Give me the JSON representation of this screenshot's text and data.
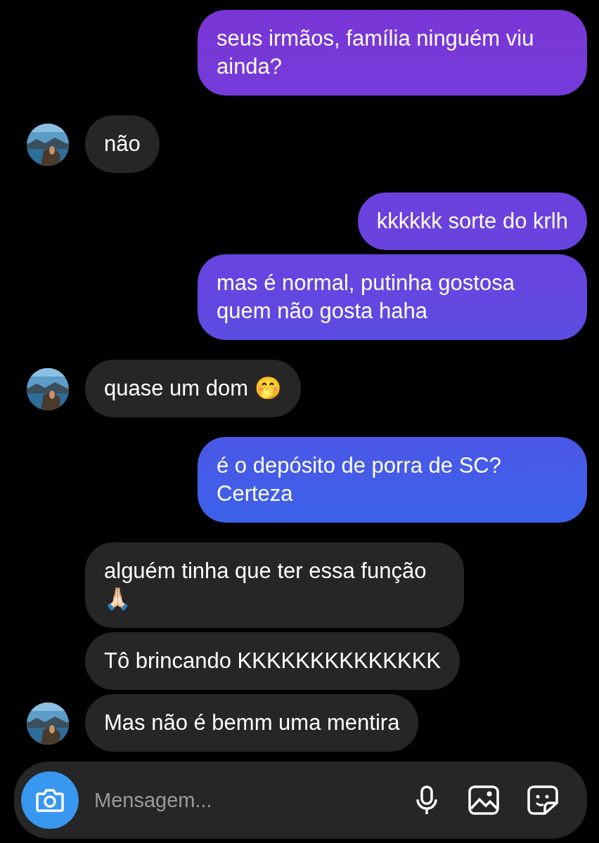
{
  "messages": [
    {
      "kind": "sent",
      "text": "seus irmãos, família ninguém viu ainda?"
    },
    {
      "kind": "received",
      "text": "não",
      "show_avatar": true
    },
    {
      "kind": "sent",
      "text": "kkkkkk sorte do krlh"
    },
    {
      "kind": "sent",
      "text": "mas é normal, putinha gostosa quem não gosta haha"
    },
    {
      "kind": "received",
      "text": "quase um dom 🤭",
      "show_avatar": true
    },
    {
      "kind": "sent",
      "text": "é o depósito de porra de SC? Certeza"
    },
    {
      "kind": "received",
      "text": "alguém tinha que ter essa função 🙏🏻",
      "show_avatar": false
    },
    {
      "kind": "received",
      "text": "Tô brincando KKKKKKKKKKKKKK",
      "show_avatar": false
    },
    {
      "kind": "received",
      "text": "Mas não é bemm uma mentira",
      "show_avatar": true
    }
  ],
  "composer": {
    "placeholder": "Mensagem..."
  }
}
